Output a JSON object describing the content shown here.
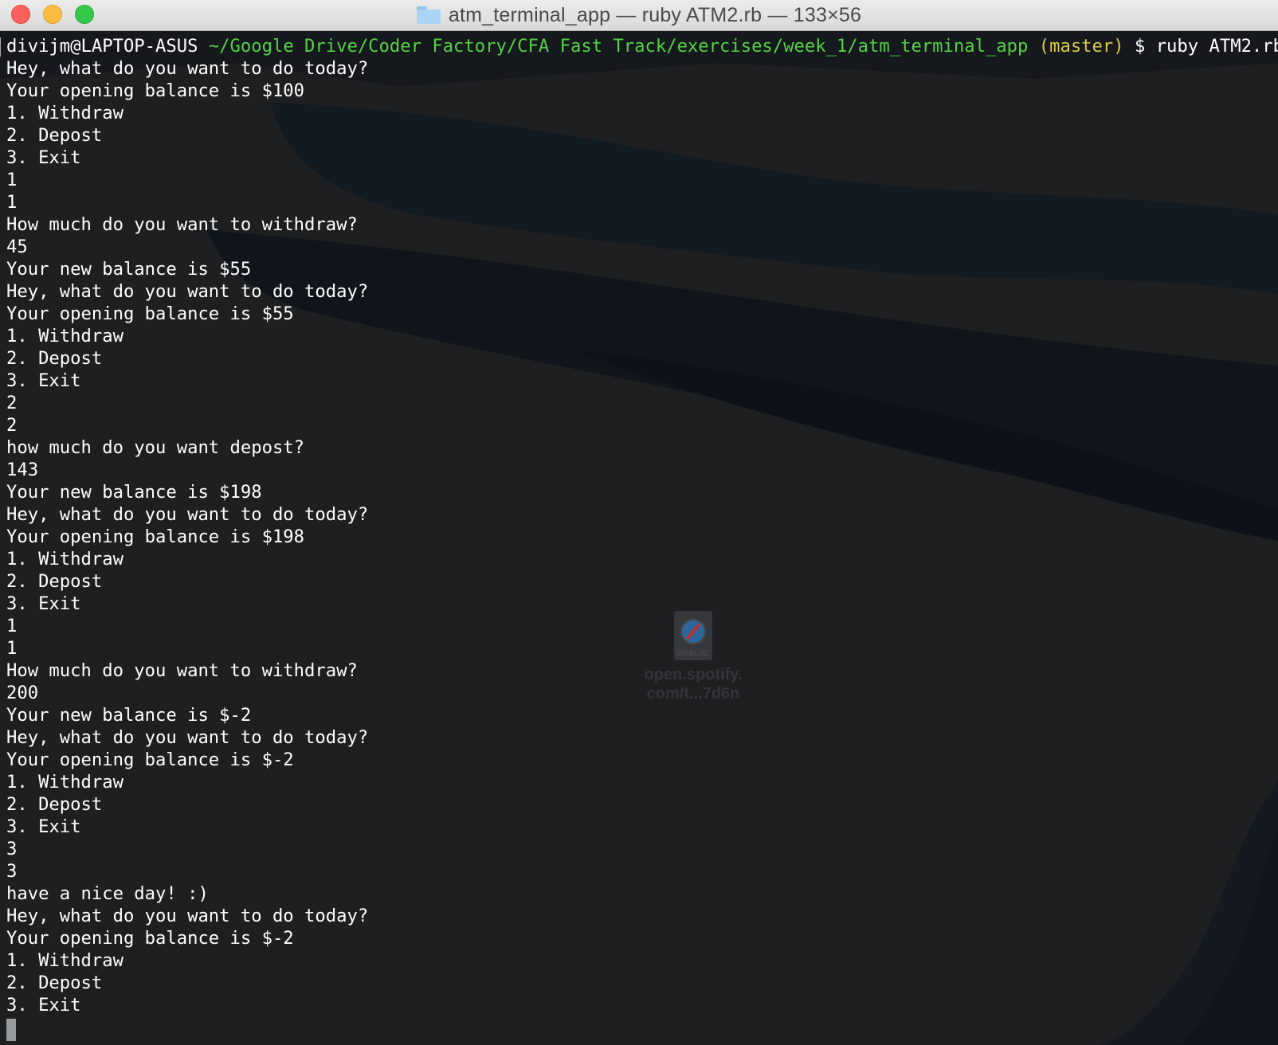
{
  "window": {
    "title": "atm_terminal_app — ruby ATM2.rb — 133×56"
  },
  "desktop_icon": {
    "badge": "WEBLOC",
    "label_line1": "open.spotify.",
    "label_line2": "com/t...7d6n"
  },
  "prompt": {
    "user_host": "divijm@LAPTOP-ASUS",
    "path": "~/Google Drive/Coder Factory/CFA Fast Track/exercises/week_1/atm_terminal_app",
    "branch": "(master)",
    "command": "$ ruby ATM2.rb"
  },
  "output_lines": [
    "Hey, what do you want to do today?",
    "Your opening balance is $100",
    "1. Withdraw",
    "2. Depost",
    "3. Exit",
    "1",
    "1",
    "How much do you want to withdraw?",
    "45",
    "Your new balance is $55",
    "Hey, what do you want to do today?",
    "Your opening balance is $55",
    "1. Withdraw",
    "2. Depost",
    "3. Exit",
    "2",
    "2",
    "how much do you want depost?",
    "143",
    "Your new balance is $198",
    "Hey, what do you want to do today?",
    "Your opening balance is $198",
    "1. Withdraw",
    "2. Depost",
    "3. Exit",
    "1",
    "1",
    "How much do you want to withdraw?",
    "200",
    "Your new balance is $-2",
    "Hey, what do you want to do today?",
    "Your opening balance is $-2",
    "1. Withdraw",
    "2. Depost",
    "3. Exit",
    "3",
    "3",
    "have a nice day! :)",
    "Hey, what do you want to do today?",
    "Your opening balance is $-2",
    "1. Withdraw",
    "2. Depost",
    "3. Exit"
  ]
}
